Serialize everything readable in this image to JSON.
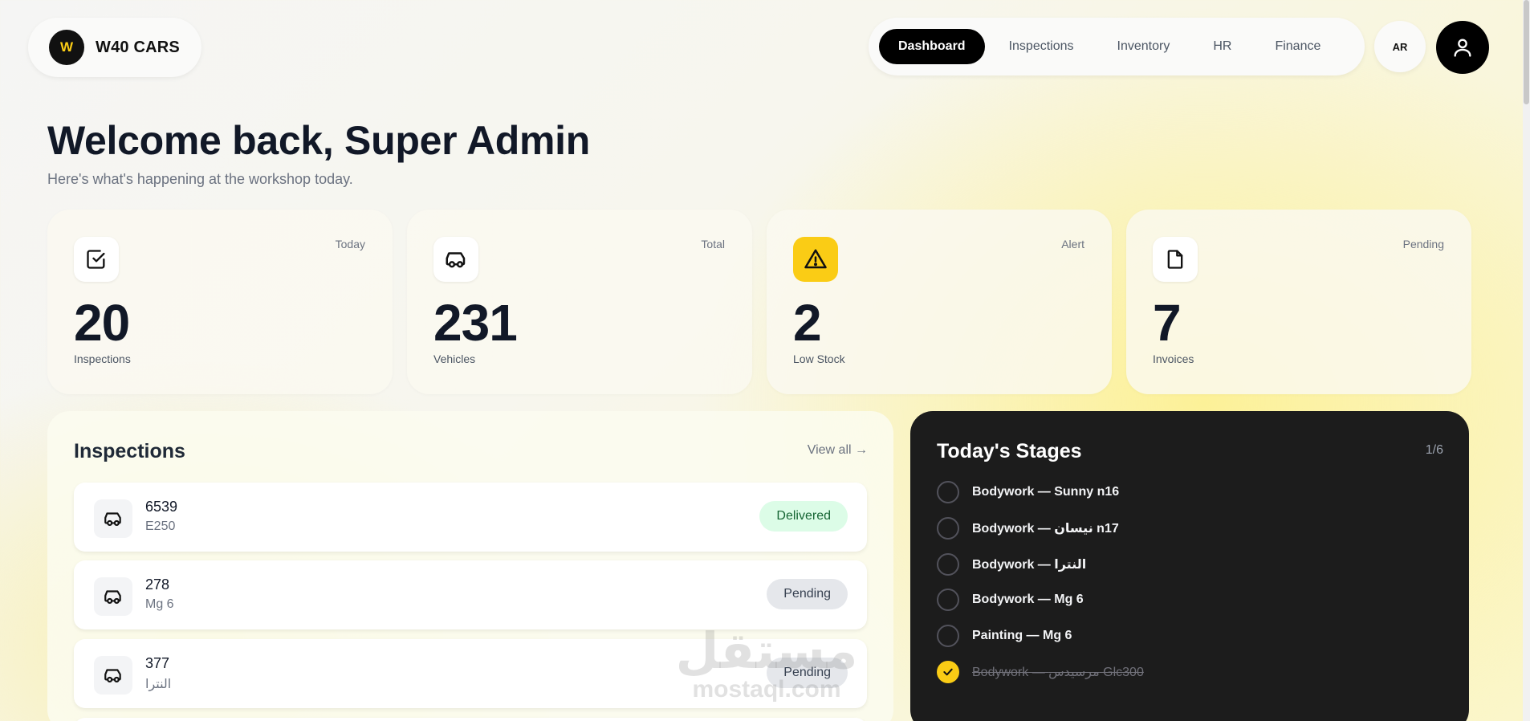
{
  "brand": {
    "logo_letter": "W",
    "name": "W40 CARS"
  },
  "nav": {
    "items": [
      {
        "label": "Dashboard",
        "active": true
      },
      {
        "label": "Inspections",
        "active": false
      },
      {
        "label": "Inventory",
        "active": false
      },
      {
        "label": "HR",
        "active": false
      },
      {
        "label": "Finance",
        "active": false
      }
    ],
    "lang_label": "AR"
  },
  "welcome": {
    "title": "Welcome back, Super Admin",
    "subtitle": "Here's what's happening at the workshop today."
  },
  "stats": [
    {
      "icon": "check-square-icon",
      "tag": "Today",
      "value": "20",
      "label": "Inspections"
    },
    {
      "icon": "car-icon",
      "tag": "Total",
      "value": "231",
      "label": "Vehicles"
    },
    {
      "icon": "warning-icon",
      "tag": "Alert",
      "value": "2",
      "label": "Low Stock"
    },
    {
      "icon": "document-icon",
      "tag": "Pending",
      "value": "7",
      "label": "Invoices"
    }
  ],
  "inspections": {
    "title": "Inspections",
    "view_all": "View all →",
    "rows": [
      {
        "id": "6539",
        "model": "E250",
        "status": "Delivered"
      },
      {
        "id": "278",
        "model": "Mg 6",
        "status": "Pending"
      },
      {
        "id": "377",
        "model": "النترا",
        "status": "Pending"
      }
    ]
  },
  "stages": {
    "title": "Today's Stages",
    "count": "1/6",
    "items": [
      {
        "label": "Bodywork — Sunny n16",
        "done": false
      },
      {
        "label": "Bodywork — نيسان n17",
        "done": false
      },
      {
        "label": "Bodywork — النترا",
        "done": false
      },
      {
        "label": "Bodywork — Mg 6",
        "done": false
      },
      {
        "label": "Painting — Mg 6",
        "done": false
      },
      {
        "label": "Bodywork — مرسيدس Glc300",
        "done": true
      }
    ]
  },
  "watermark": {
    "arabic": "مستقل",
    "latin": "mostaql.com"
  },
  "colors": {
    "accent": "#facc15",
    "dark": "#000000",
    "delivered_bg": "#dcfce7",
    "pending_bg": "#e5e7eb"
  }
}
